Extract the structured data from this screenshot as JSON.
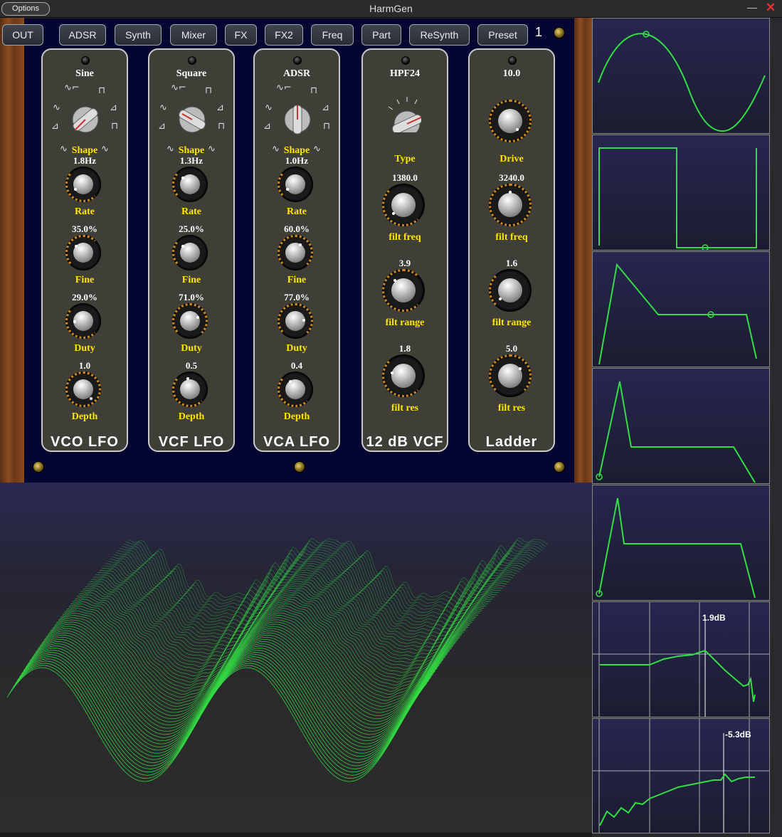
{
  "window": {
    "title": "HarmGen",
    "options_label": "Options",
    "minimize": "—",
    "close": "✕"
  },
  "nav": {
    "buttons": [
      "OUT",
      "ADSR",
      "Synth",
      "Mixer",
      "FX",
      "FX2",
      "Freq",
      "Part",
      "ReSynth",
      "Preset"
    ],
    "preset_number": "1"
  },
  "modules": [
    {
      "name": "VCO LFO",
      "shape_value": "Sine",
      "shape_label": "Shape",
      "knobs": [
        {
          "value": "1.8Hz",
          "label": "Rate"
        },
        {
          "value": "35.0%",
          "label": "Fine"
        },
        {
          "value": "29.0%",
          "label": "Duty"
        },
        {
          "value": "1.0",
          "label": "Depth"
        }
      ]
    },
    {
      "name": "VCF LFO",
      "shape_value": "Square",
      "shape_label": "Shape",
      "knobs": [
        {
          "value": "1.3Hz",
          "label": "Rate"
        },
        {
          "value": "25.0%",
          "label": "Fine"
        },
        {
          "value": "71.0%",
          "label": "Duty"
        },
        {
          "value": "0.5",
          "label": "Depth"
        }
      ]
    },
    {
      "name": "VCA LFO",
      "shape_value": "ADSR",
      "shape_label": "Shape",
      "knobs": [
        {
          "value": "1.0Hz",
          "label": "Rate"
        },
        {
          "value": "60.0%",
          "label": "Fine"
        },
        {
          "value": "77.0%",
          "label": "Duty"
        },
        {
          "value": "0.4",
          "label": "Depth"
        }
      ]
    },
    {
      "name": "12 dB VCF",
      "type_value": "HPF24",
      "type_label": "Type",
      "knobs": [
        {
          "value": "1380.0",
          "label": "filt freq"
        },
        {
          "value": "3.9",
          "label": "filt range"
        },
        {
          "value": "1.8",
          "label": "filt res"
        }
      ]
    },
    {
      "name": "Ladder",
      "drive_value": "10.0",
      "drive_label": "Drive",
      "knobs": [
        {
          "value": "3240.0",
          "label": "filt freq"
        },
        {
          "value": "1.6",
          "label": "filt range"
        },
        {
          "value": "5.0",
          "label": "filt res"
        }
      ]
    }
  ],
  "scopes": {
    "filter1_readout": "1.9dB",
    "filter2_readout": "-5.3dB"
  },
  "colors": {
    "trace": "#33dd44",
    "label": "#ffe600",
    "panel": "#050532"
  }
}
